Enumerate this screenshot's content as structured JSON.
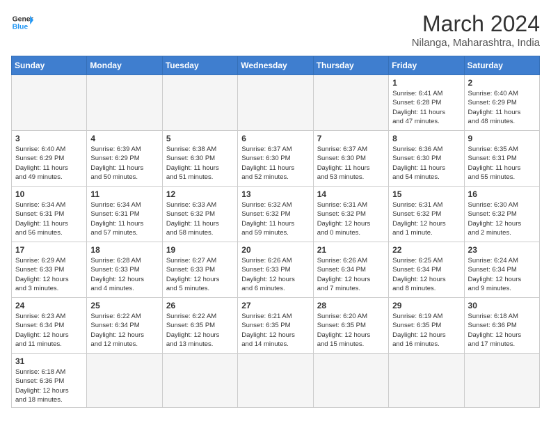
{
  "header": {
    "logo_general": "General",
    "logo_blue": "Blue",
    "month_year": "March 2024",
    "location": "Nilanga, Maharashtra, India"
  },
  "weekdays": [
    "Sunday",
    "Monday",
    "Tuesday",
    "Wednesday",
    "Thursday",
    "Friday",
    "Saturday"
  ],
  "weeks": [
    [
      {
        "day": "",
        "info": ""
      },
      {
        "day": "",
        "info": ""
      },
      {
        "day": "",
        "info": ""
      },
      {
        "day": "",
        "info": ""
      },
      {
        "day": "",
        "info": ""
      },
      {
        "day": "1",
        "info": "Sunrise: 6:41 AM\nSunset: 6:28 PM\nDaylight: 11 hours\nand 47 minutes."
      },
      {
        "day": "2",
        "info": "Sunrise: 6:40 AM\nSunset: 6:29 PM\nDaylight: 11 hours\nand 48 minutes."
      }
    ],
    [
      {
        "day": "3",
        "info": "Sunrise: 6:40 AM\nSunset: 6:29 PM\nDaylight: 11 hours\nand 49 minutes."
      },
      {
        "day": "4",
        "info": "Sunrise: 6:39 AM\nSunset: 6:29 PM\nDaylight: 11 hours\nand 50 minutes."
      },
      {
        "day": "5",
        "info": "Sunrise: 6:38 AM\nSunset: 6:30 PM\nDaylight: 11 hours\nand 51 minutes."
      },
      {
        "day": "6",
        "info": "Sunrise: 6:37 AM\nSunset: 6:30 PM\nDaylight: 11 hours\nand 52 minutes."
      },
      {
        "day": "7",
        "info": "Sunrise: 6:37 AM\nSunset: 6:30 PM\nDaylight: 11 hours\nand 53 minutes."
      },
      {
        "day": "8",
        "info": "Sunrise: 6:36 AM\nSunset: 6:30 PM\nDaylight: 11 hours\nand 54 minutes."
      },
      {
        "day": "9",
        "info": "Sunrise: 6:35 AM\nSunset: 6:31 PM\nDaylight: 11 hours\nand 55 minutes."
      }
    ],
    [
      {
        "day": "10",
        "info": "Sunrise: 6:34 AM\nSunset: 6:31 PM\nDaylight: 11 hours\nand 56 minutes."
      },
      {
        "day": "11",
        "info": "Sunrise: 6:34 AM\nSunset: 6:31 PM\nDaylight: 11 hours\nand 57 minutes."
      },
      {
        "day": "12",
        "info": "Sunrise: 6:33 AM\nSunset: 6:32 PM\nDaylight: 11 hours\nand 58 minutes."
      },
      {
        "day": "13",
        "info": "Sunrise: 6:32 AM\nSunset: 6:32 PM\nDaylight: 11 hours\nand 59 minutes."
      },
      {
        "day": "14",
        "info": "Sunrise: 6:31 AM\nSunset: 6:32 PM\nDaylight: 12 hours\nand 0 minutes."
      },
      {
        "day": "15",
        "info": "Sunrise: 6:31 AM\nSunset: 6:32 PM\nDaylight: 12 hours\nand 1 minute."
      },
      {
        "day": "16",
        "info": "Sunrise: 6:30 AM\nSunset: 6:32 PM\nDaylight: 12 hours\nand 2 minutes."
      }
    ],
    [
      {
        "day": "17",
        "info": "Sunrise: 6:29 AM\nSunset: 6:33 PM\nDaylight: 12 hours\nand 3 minutes."
      },
      {
        "day": "18",
        "info": "Sunrise: 6:28 AM\nSunset: 6:33 PM\nDaylight: 12 hours\nand 4 minutes."
      },
      {
        "day": "19",
        "info": "Sunrise: 6:27 AM\nSunset: 6:33 PM\nDaylight: 12 hours\nand 5 minutes."
      },
      {
        "day": "20",
        "info": "Sunrise: 6:26 AM\nSunset: 6:33 PM\nDaylight: 12 hours\nand 6 minutes."
      },
      {
        "day": "21",
        "info": "Sunrise: 6:26 AM\nSunset: 6:34 PM\nDaylight: 12 hours\nand 7 minutes."
      },
      {
        "day": "22",
        "info": "Sunrise: 6:25 AM\nSunset: 6:34 PM\nDaylight: 12 hours\nand 8 minutes."
      },
      {
        "day": "23",
        "info": "Sunrise: 6:24 AM\nSunset: 6:34 PM\nDaylight: 12 hours\nand 9 minutes."
      }
    ],
    [
      {
        "day": "24",
        "info": "Sunrise: 6:23 AM\nSunset: 6:34 PM\nDaylight: 12 hours\nand 11 minutes."
      },
      {
        "day": "25",
        "info": "Sunrise: 6:22 AM\nSunset: 6:34 PM\nDaylight: 12 hours\nand 12 minutes."
      },
      {
        "day": "26",
        "info": "Sunrise: 6:22 AM\nSunset: 6:35 PM\nDaylight: 12 hours\nand 13 minutes."
      },
      {
        "day": "27",
        "info": "Sunrise: 6:21 AM\nSunset: 6:35 PM\nDaylight: 12 hours\nand 14 minutes."
      },
      {
        "day": "28",
        "info": "Sunrise: 6:20 AM\nSunset: 6:35 PM\nDaylight: 12 hours\nand 15 minutes."
      },
      {
        "day": "29",
        "info": "Sunrise: 6:19 AM\nSunset: 6:35 PM\nDaylight: 12 hours\nand 16 minutes."
      },
      {
        "day": "30",
        "info": "Sunrise: 6:18 AM\nSunset: 6:36 PM\nDaylight: 12 hours\nand 17 minutes."
      }
    ],
    [
      {
        "day": "31",
        "info": "Sunrise: 6:18 AM\nSunset: 6:36 PM\nDaylight: 12 hours\nand 18 minutes."
      },
      {
        "day": "",
        "info": ""
      },
      {
        "day": "",
        "info": ""
      },
      {
        "day": "",
        "info": ""
      },
      {
        "day": "",
        "info": ""
      },
      {
        "day": "",
        "info": ""
      },
      {
        "day": "",
        "info": ""
      }
    ]
  ]
}
